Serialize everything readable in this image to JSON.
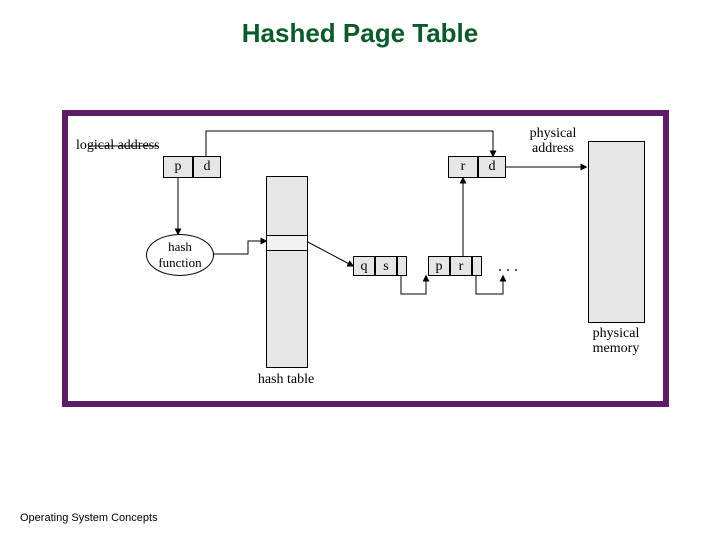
{
  "title": "Hashed Page Table",
  "labels": {
    "logical_address": "logical address",
    "physical_address": "physical\naddress",
    "hash_function": "hash\nfunction",
    "hash_table": "hash table",
    "physical_memory": "physical\nmemory"
  },
  "logical_addr": {
    "page": "p",
    "offset": "d"
  },
  "physical_addr": {
    "frame": "r",
    "offset": "d"
  },
  "chain_node1": {
    "key": "q",
    "value": "s"
  },
  "chain_node2": {
    "key": "p",
    "value": "r"
  },
  "ellipsis": ". . .",
  "footer": "Operating System Concepts"
}
